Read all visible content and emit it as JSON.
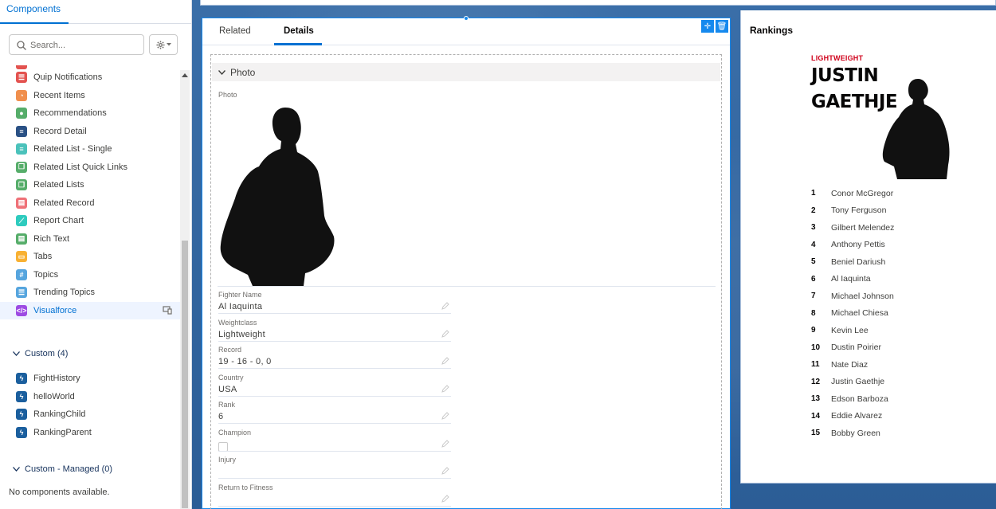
{
  "left_panel": {
    "tab_label": "Components",
    "search_placeholder": "Search...",
    "standard_items": [
      {
        "label": "Quip Notifications",
        "icon": "quip-icon",
        "color": "#e3524f",
        "glyph": "☰"
      },
      {
        "label": "Recent Items",
        "icon": "clock-icon",
        "color": "#f08f4d",
        "glyph": "◔"
      },
      {
        "label": "Recommendations",
        "icon": "lightbulb-icon",
        "color": "#56ad6a",
        "glyph": "●"
      },
      {
        "label": "Record Detail",
        "icon": "record-detail-icon",
        "color": "#2a5185",
        "glyph": "≡"
      },
      {
        "label": "Related List - Single",
        "icon": "related-list-icon",
        "color": "#4bc2bb",
        "glyph": "≡"
      },
      {
        "label": "Related List Quick Links",
        "icon": "quick-links-icon",
        "color": "#56ad6a",
        "glyph": "❐"
      },
      {
        "label": "Related Lists",
        "icon": "related-lists-icon",
        "color": "#56ad6a",
        "glyph": "❐"
      },
      {
        "label": "Related Record",
        "icon": "related-record-icon",
        "color": "#ef7178",
        "glyph": "▤"
      },
      {
        "label": "Report Chart",
        "icon": "report-chart-icon",
        "color": "#2ecbbe",
        "glyph": "⟋"
      },
      {
        "label": "Rich Text",
        "icon": "rich-text-icon",
        "color": "#56ad6a",
        "glyph": "▤"
      },
      {
        "label": "Tabs",
        "icon": "tabs-icon",
        "color": "#f8b133",
        "glyph": "▭"
      },
      {
        "label": "Topics",
        "icon": "topics-icon",
        "color": "#56a5de",
        "glyph": "#"
      },
      {
        "label": "Trending Topics",
        "icon": "trending-topics-icon",
        "color": "#56a5de",
        "glyph": "☰"
      },
      {
        "label": "Visualforce",
        "icon": "visualforce-icon",
        "color": "#9d4be3",
        "glyph": "</>"
      }
    ],
    "custom_section": "Custom (4)",
    "custom_items": [
      {
        "label": "FightHistory"
      },
      {
        "label": "helloWorld"
      },
      {
        "label": "RankingChild"
      },
      {
        "label": "RankingParent"
      }
    ],
    "managed_section": "Custom - Managed (0)",
    "no_components": "No components available."
  },
  "detail": {
    "tabs": [
      "Related",
      "Details"
    ],
    "section_title": "Photo",
    "photo_label": "Photo",
    "fields": [
      {
        "label": "Fighter Name",
        "value": "Al Iaquinta"
      },
      {
        "label": "Weightclass",
        "value": "Lightweight"
      },
      {
        "label": "Record",
        "value": "19 - 16 - 0, 0"
      },
      {
        "label": "Country",
        "value": "USA"
      },
      {
        "label": "Rank",
        "value": "6"
      },
      {
        "label": "Champion",
        "value": ""
      },
      {
        "label": "Injury",
        "value": ""
      },
      {
        "label": "Return to Fitness",
        "value": ""
      }
    ]
  },
  "rankings": {
    "title": "Rankings",
    "weight_class": "LIGHTWEIGHT",
    "first_name": "JUSTIN",
    "last_name": "GAETHJE",
    "list": [
      {
        "rank": "1",
        "name": "Conor McGregor"
      },
      {
        "rank": "2",
        "name": "Tony Ferguson"
      },
      {
        "rank": "3",
        "name": "Gilbert Melendez"
      },
      {
        "rank": "4",
        "name": "Anthony Pettis"
      },
      {
        "rank": "5",
        "name": "Beniel Dariush"
      },
      {
        "rank": "6",
        "name": "Al Iaquinta"
      },
      {
        "rank": "7",
        "name": "Michael Johnson"
      },
      {
        "rank": "8",
        "name": "Michael Chiesa"
      },
      {
        "rank": "9",
        "name": "Kevin Lee"
      },
      {
        "rank": "10",
        "name": "Dustin Poirier"
      },
      {
        "rank": "11",
        "name": "Nate Diaz"
      },
      {
        "rank": "12",
        "name": "Justin Gaethje"
      },
      {
        "rank": "13",
        "name": "Edson Barboza"
      },
      {
        "rank": "14",
        "name": "Eddie Alvarez"
      },
      {
        "rank": "15",
        "name": "Bobby Green"
      }
    ]
  },
  "colors": {
    "accent": "#0070d2",
    "weight_class_red": "#d0021b",
    "lightning_blue": "#1b5f9e"
  }
}
